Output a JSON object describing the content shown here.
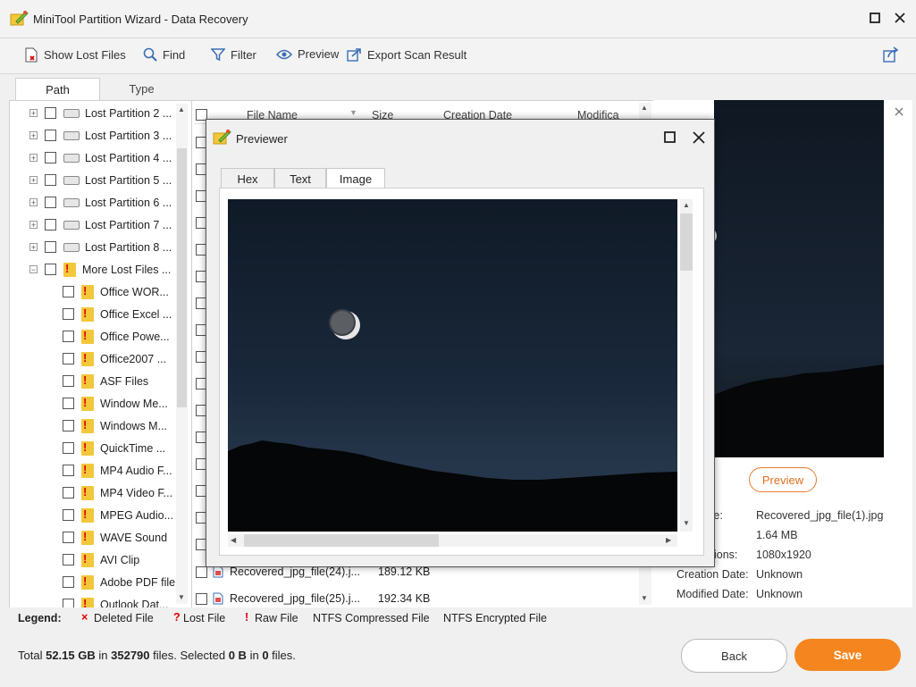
{
  "app": {
    "title": "MiniTool Partition Wizard - Data Recovery"
  },
  "toolbar": {
    "show_lost_files": "Show Lost Files",
    "find": "Find",
    "filter": "Filter",
    "preview": "Preview",
    "export": "Export Scan Result"
  },
  "tabs": {
    "path": "Path",
    "type": "Type"
  },
  "tree": {
    "partitions": [
      "Lost Partition 2 ...",
      "Lost Partition 3 ...",
      "Lost Partition 4 ...",
      "Lost Partition 5 ...",
      "Lost Partition 6 ...",
      "Lost Partition 7 ...",
      "Lost Partition 8 ..."
    ],
    "more_lost_files": "More Lost Files ...",
    "children": [
      "Office WOR...",
      "Office Excel ...",
      "Office Powe...",
      "Office2007 ...",
      "ASF Files",
      "Window Me...",
      "Windows M...",
      "QuickTime ...",
      "MP4 Audio F...",
      "MP4 Video F...",
      "MPEG Audio...",
      "WAVE Sound",
      "AVI Clip",
      "Adobe PDF file",
      "Outlook Dat..."
    ]
  },
  "filelist": {
    "columns": [
      "File Name",
      "Size",
      "Creation Date",
      "Modifica"
    ],
    "rows": [
      {
        "name": "Recovered_jpg_file(24).j...",
        "size": "189.12 KB"
      },
      {
        "name": "Recovered_jpg_file(25).j...",
        "size": "192.34 KB"
      }
    ]
  },
  "right_panel": {
    "preview_button": "Preview",
    "file_name_label": "me:",
    "file_name_value": "Recovered_jpg_file(1).jpg",
    "size_value": "1.64 MB",
    "dimensions_label": "ions:",
    "dimensions_value": "1080x1920",
    "creation_label": "Creation Date:",
    "creation_value": "Unknown",
    "modified_label": "Modified Date:",
    "modified_value": "Unknown"
  },
  "legend": {
    "label": "Legend:",
    "deleted": "Deleted File",
    "lost": "Lost File",
    "raw": "Raw File",
    "ntfs_compressed": "NTFS Compressed File",
    "ntfs_encrypted": "NTFS Encrypted File"
  },
  "status": {
    "total_prefix": "Total",
    "total_size": "52.15 GB",
    "in1": "in",
    "total_files": "352790",
    "files_selected": "files.  Selected",
    "selected_size": "0 B",
    "in2": "in",
    "selected_files": "0",
    "files_end": "files."
  },
  "buttons": {
    "back": "Back",
    "save": "Save"
  },
  "previewer": {
    "title": "Previewer",
    "tabs": [
      "Hex",
      "Text",
      "Image"
    ]
  },
  "colors": {
    "accent": "#f5861f",
    "legend_red": "#e00000",
    "ntfs_compressed": "#2a6ad4",
    "ntfs_encrypted": "#2a9a3a"
  }
}
